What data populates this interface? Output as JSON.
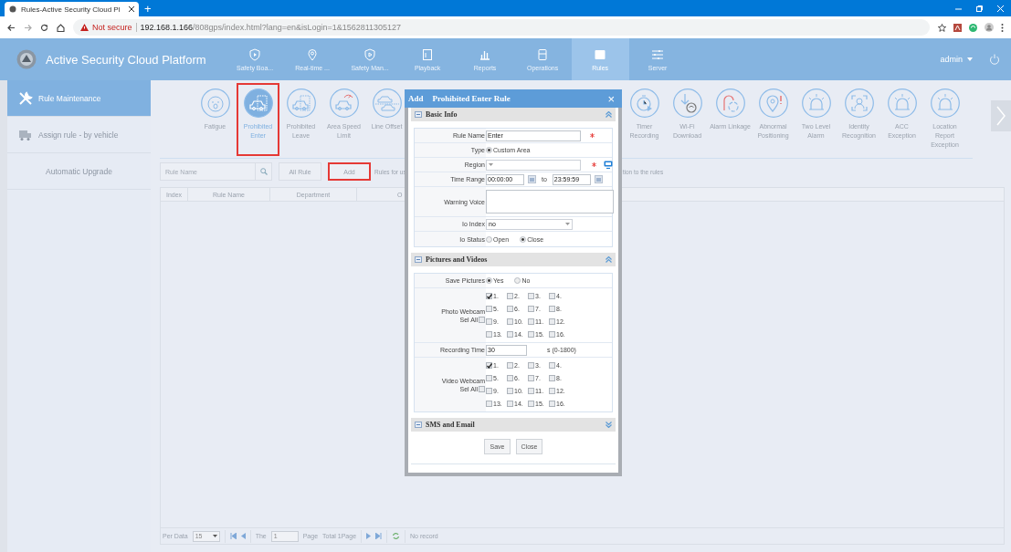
{
  "browser": {
    "tab_title": "Rules-Active Security Cloud Pl",
    "new_tab": "+",
    "security_warning": "Not secure",
    "url_host": "192.168.1.166",
    "url_path": "/808gps/index.html?lang=en&isLogin=1&1562811305127"
  },
  "app": {
    "title": "Active Security Cloud Platform",
    "user": "admin",
    "nav": [
      {
        "label": "Safety Boa...",
        "selected": false
      },
      {
        "label": "Real-time ...",
        "selected": false
      },
      {
        "label": "Safety Man...",
        "selected": false
      },
      {
        "label": "Playback",
        "selected": false
      },
      {
        "label": "Reports",
        "selected": false
      },
      {
        "label": "Operations",
        "selected": false
      },
      {
        "label": "Rules",
        "selected": true
      },
      {
        "label": "Server",
        "selected": false
      }
    ]
  },
  "sidebar": [
    {
      "label": "Rule Maintenance",
      "selected": true
    },
    {
      "label": "Assign rule - by vehicle",
      "selected": false
    },
    {
      "label": "Automatic Upgrade",
      "selected": false
    }
  ],
  "rule_types": [
    {
      "label": "Fatigue",
      "selected": false,
      "annotated": false
    },
    {
      "label": "Prohibited Enter",
      "selected": true,
      "annotated": true
    },
    {
      "label": "Prohibited Leave",
      "selected": false,
      "annotated": false
    },
    {
      "label": "Area Speed Limit",
      "selected": false,
      "annotated": false
    },
    {
      "label": "Line Offset",
      "selected": false,
      "annotated": false
    }
  ],
  "rule_types_more": [
    {
      "label": "Timer Recording",
      "selected": false,
      "annotated": false
    },
    {
      "label": "Wi-Fi Download",
      "selected": false,
      "annotated": false
    },
    {
      "label": "Alarm Linkage",
      "selected": false,
      "annotated": false
    },
    {
      "label": "Abnormal Positioning",
      "selected": false,
      "annotated": false
    },
    {
      "label": "Two Level Alarm",
      "selected": false,
      "annotated": false
    },
    {
      "label": "Identity Recognition",
      "selected": false,
      "annotated": false
    },
    {
      "label": "ACC Exception",
      "selected": false,
      "annotated": false
    },
    {
      "label": "Location Report Exception",
      "selected": false,
      "annotated": false
    }
  ],
  "toolbar": {
    "search_placeholder": "Rule Name",
    "buttons": [
      {
        "label": "All Rule",
        "annotated": false
      },
      {
        "label": "Add",
        "annotated": true
      }
    ],
    "note_start": "Rules for us",
    "note_end": "tion to the rules"
  },
  "table": {
    "columns": [
      "Index",
      "Rule Name",
      "Department",
      "O"
    ]
  },
  "pager": {
    "per_data_label": "Per Data",
    "per_data": "15",
    "page_prefix": "The",
    "page": "1",
    "page_suffix": "Page",
    "total": "Total 1Page",
    "status": "No record"
  },
  "dialog": {
    "title_prefix": "Add",
    "title": "Prohibited Enter Rule",
    "close": "×",
    "buttons": [
      "Save",
      "Close"
    ],
    "sections": [
      {
        "title": "Basic Info",
        "expanded": true,
        "rows": [
          {
            "kind": "text",
            "label": "Rule Name",
            "value": "Enter",
            "required": true
          },
          {
            "kind": "radio",
            "label": "Type",
            "options": [
              {
                "label": "Custom Area",
                "selected": true
              }
            ]
          },
          {
            "kind": "select",
            "label": "Region",
            "required": true,
            "map_picker": true
          },
          {
            "kind": "time_range",
            "label": "Time Range",
            "from": "00:00:00",
            "to_label": "to",
            "to": "23:59:59"
          },
          {
            "kind": "textarea",
            "label": "Warning Voice"
          },
          {
            "kind": "select",
            "label": "Io Index",
            "value": "no",
            "required": false,
            "map_picker": false
          },
          {
            "kind": "radio",
            "label": "Io Status",
            "options": [
              {
                "label": "Open",
                "selected": false
              },
              {
                "label": "Close",
                "selected": true
              }
            ]
          }
        ]
      },
      {
        "title": "Pictures and Videos",
        "expanded": true,
        "rows": [
          {
            "kind": "radio",
            "label": "Save Pictures",
            "options": [
              {
                "label": "Yes",
                "selected": true
              },
              {
                "label": "No",
                "selected": false
              }
            ]
          },
          {
            "kind": "cams",
            "label": "Photo Webcam",
            "sel_all_label": "Sel All",
            "sel_all_checked": false,
            "cams": [
              {
                "label": "1.",
                "checked": true
              },
              {
                "label": "2.",
                "checked": false
              },
              {
                "label": "3.",
                "checked": false
              },
              {
                "label": "4.",
                "checked": false
              },
              {
                "label": "5.",
                "checked": false
              },
              {
                "label": "6.",
                "checked": false
              },
              {
                "label": "7.",
                "checked": false
              },
              {
                "label": "8.",
                "checked": false
              },
              {
                "label": "9.",
                "checked": false
              },
              {
                "label": "10.",
                "checked": false
              },
              {
                "label": "11.",
                "checked": false
              },
              {
                "label": "12.",
                "checked": false
              },
              {
                "label": "13.",
                "checked": false
              },
              {
                "label": "14.",
                "checked": false
              },
              {
                "label": "15.",
                "checked": false
              },
              {
                "label": "16.",
                "checked": false
              }
            ]
          },
          {
            "kind": "text",
            "label": "Recording Time",
            "value": "30",
            "required": false,
            "suffix": "s (0-1800)"
          },
          {
            "kind": "cams",
            "label": "Video Webcam",
            "sel_all_label": "Sel All",
            "sel_all_checked": false,
            "cams": [
              {
                "label": "1.",
                "checked": true
              },
              {
                "label": "2.",
                "checked": false
              },
              {
                "label": "3.",
                "checked": false
              },
              {
                "label": "4.",
                "checked": false
              },
              {
                "label": "5.",
                "checked": false
              },
              {
                "label": "6.",
                "checked": false
              },
              {
                "label": "7.",
                "checked": false
              },
              {
                "label": "8.",
                "checked": false
              },
              {
                "label": "9.",
                "checked": false
              },
              {
                "label": "10.",
                "checked": false
              },
              {
                "label": "11.",
                "checked": false
              },
              {
                "label": "12.",
                "checked": false
              },
              {
                "label": "13.",
                "checked": false
              },
              {
                "label": "14.",
                "checked": false
              },
              {
                "label": "15.",
                "checked": false
              },
              {
                "label": "16.",
                "checked": false
              }
            ]
          }
        ]
      },
      {
        "title": "SMS and Email",
        "expanded": false
      }
    ]
  }
}
